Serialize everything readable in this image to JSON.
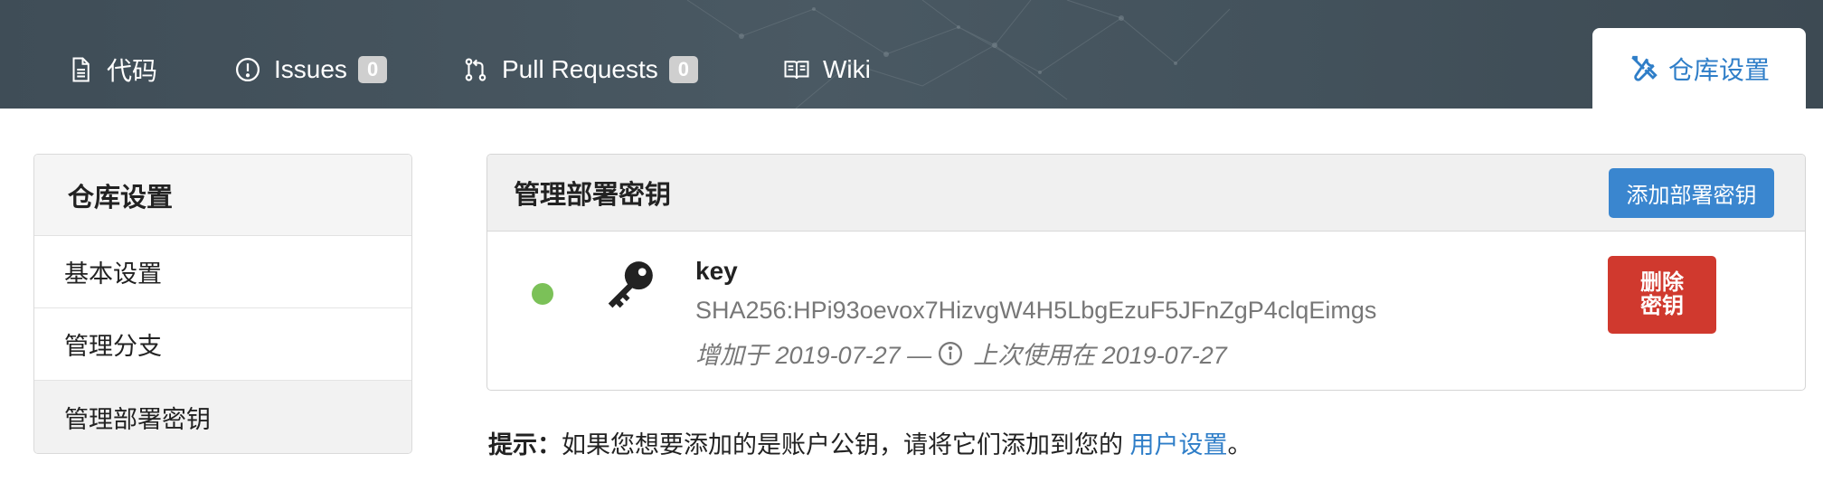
{
  "nav": {
    "code": "代码",
    "issues": "Issues",
    "issues_count": "0",
    "pulls": "Pull Requests",
    "pulls_count": "0",
    "wiki": "Wiki",
    "settings": "仓库设置"
  },
  "sidebar": {
    "title": "仓库设置",
    "items": [
      {
        "label": "基本设置"
      },
      {
        "label": "管理分支"
      },
      {
        "label": "管理部署密钥"
      }
    ]
  },
  "panel": {
    "title": "管理部署密钥",
    "add_button": "添加部署密钥",
    "key": {
      "name": "key",
      "fingerprint": "SHA256:HPi93oevox7HizvgW4H5LbgEzuF5JFnZgP4clqEimgs",
      "added": "增加于 2019-07-27 —",
      "last_used": "上次使用在 2019-07-27",
      "status_color": "#7bc158",
      "delete_button_line1": "删除",
      "delete_button_line2": "密钥"
    }
  },
  "hint": {
    "label": "提示：",
    "text": "如果您想要添加的是账户公钥，请将它们添加到您的 ",
    "link": "用户设置",
    "suffix": "。"
  },
  "colors": {
    "header_bg": "#43525c",
    "accent": "#2f7ec8",
    "danger": "#d0392e"
  }
}
